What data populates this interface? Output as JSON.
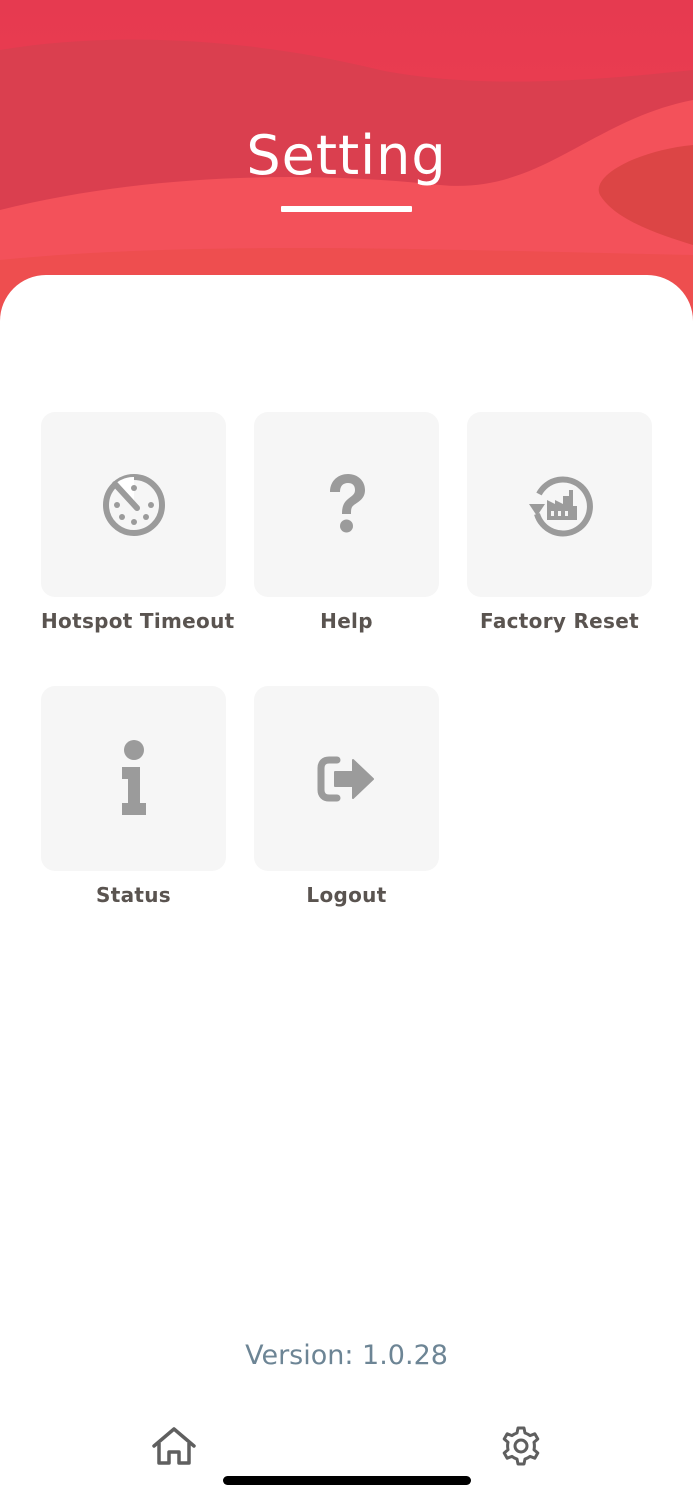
{
  "header": {
    "title": "Setting",
    "gradient_colors": [
      "#e4394f",
      "#f23a52",
      "#d9414a",
      "#f05553",
      "#ef4f52"
    ]
  },
  "menu": {
    "items": [
      {
        "label": "Hotspot Timeout",
        "icon": "timer-off-icon"
      },
      {
        "label": "Help",
        "icon": "question-mark-icon"
      },
      {
        "label": "Factory Reset",
        "icon": "factory-reset-icon"
      },
      {
        "label": "Status",
        "icon": "info-icon"
      },
      {
        "label": "Logout",
        "icon": "logout-icon"
      }
    ]
  },
  "footer": {
    "version_text": "Version: 1.0.28"
  },
  "tabbar": {
    "items": [
      {
        "name": "home",
        "icon": "home-icon"
      },
      {
        "name": "settings",
        "icon": "gear-icon"
      }
    ]
  },
  "colors": {
    "icon_gray": "#9b9b9b",
    "tile_bg": "#f6f6f6",
    "label": "#5a5450",
    "version": "#6d8595"
  }
}
